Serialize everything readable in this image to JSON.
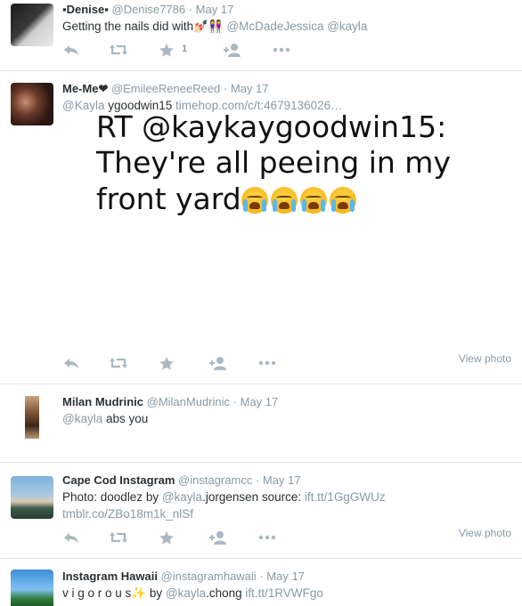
{
  "tweets": [
    {
      "name": "▪Denise▪",
      "handle": "@Denise7786",
      "dot": "·",
      "time": "May 17",
      "text_main": "Getting the nails did with💅🏻👭",
      "mentions": "@McDadeJessica @kayla",
      "favorite_count": "1"
    },
    {
      "name": "Me-Me❤",
      "handle": "@EmileeReneeReed",
      "dot": "·",
      "time": "May 17",
      "text_mention": "@Kayla",
      "text_main": " ygoodwin15 ",
      "text_link": "timehop.com/c/t:4679136026…",
      "image_line1": "RT @kaykaygoodwin15:",
      "image_line2": "They're all peeing in my",
      "image_line3": "front yard",
      "view_photo": "View photo"
    },
    {
      "name": "Milan Mudrinic",
      "handle": "@MilanMudrinic",
      "dot": "·",
      "time": "May 17",
      "text_mention": "@kayla",
      "text_main": " abs you"
    },
    {
      "name": "Cape Cod Instagram",
      "handle": "@instagramcc",
      "dot": "·",
      "time": "May 17",
      "line1_a": "Photo: doodlez by ",
      "line1_mention": "@kayla",
      "line1_b": ".jorgensen source: ",
      "line1_link": "ift.tt/1GgGWUz",
      "line2_link": "tmblr.co/ZBo18m1k_nlSf",
      "view_photo": "View photo"
    },
    {
      "name": "Instagram Hawaii",
      "handle": "@instagramhawaii",
      "dot": "·",
      "time": "May 17",
      "text_a": "v i g o r o u s✨ by ",
      "text_mention": "@kayla",
      "text_b": ".chong ",
      "text_link": "ift.tt/1RVWFgo"
    }
  ],
  "icons": [
    "reply-icon",
    "retweet-icon",
    "favorite-icon",
    "follow-icon",
    "more-icon"
  ],
  "colors": {
    "link": "#8899a6",
    "text": "#292f33",
    "icon": "#aab8c2",
    "divider": "#e1e8ed"
  }
}
